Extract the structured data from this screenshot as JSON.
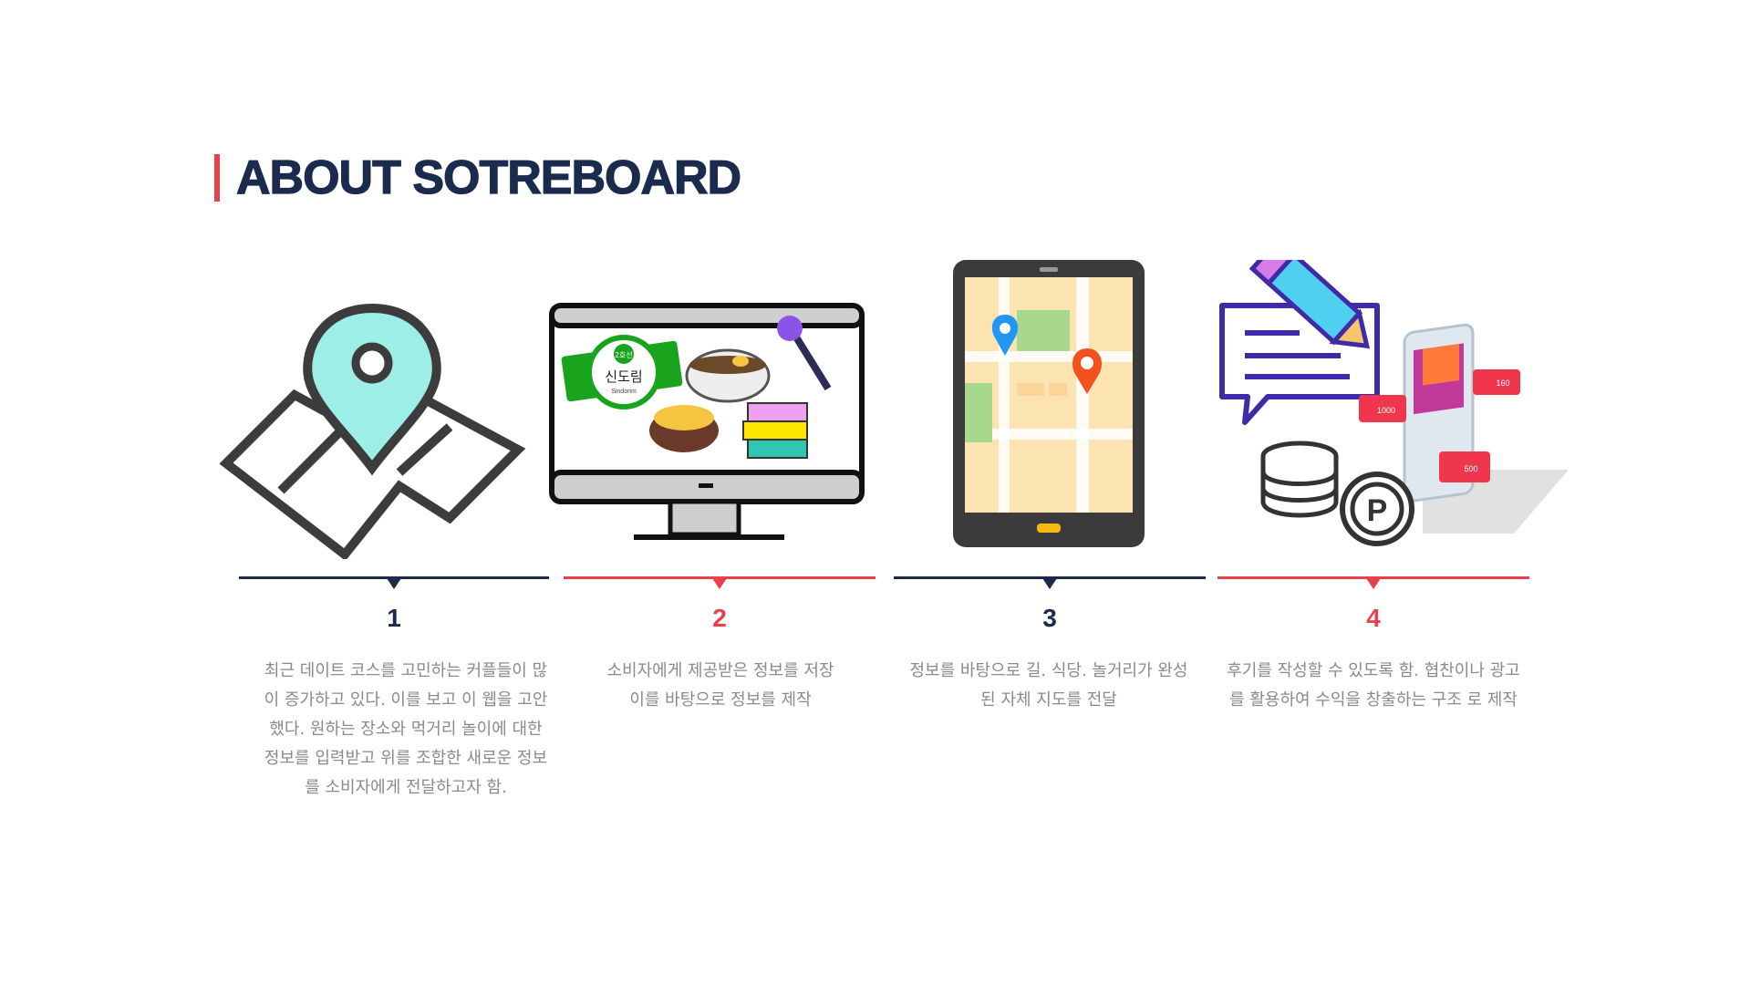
{
  "page": {
    "title": "ABOUT SOTREBOARD"
  },
  "colors": {
    "navy": "#1b2b4e",
    "red": "#e8414b",
    "text_gray": "#8a8a8a"
  },
  "steps": [
    {
      "number": "1",
      "icon": "map-pin-icon",
      "description": "최근 데이트 코스를 고민하는 커플들이 많이 증가하고 있다. 이를 보고 이 웹을 고안했다. 원하는 장소와 먹거리 놀이에 대한 정보를 입력받고 위를 조합한 새로운 정보를 소비자에게 전달하고자 함."
    },
    {
      "number": "2",
      "icon": "monitor-icon",
      "description": "소비자에게 제공받은 정보를 저장 이를 바탕으로 정보를 제작"
    },
    {
      "number": "3",
      "icon": "tablet-map-icon",
      "description": "정보를 바탕으로 길. 식당. 놀거리가 완성된 자체 지도를 전달"
    },
    {
      "number": "4",
      "icon": "review-revenue-icon",
      "description": "후기를 작성할 수 있도록 함. 협찬이나 광고를 활용하여 수익을 창출하는 구조 로 제작"
    }
  ],
  "monitor_screen": {
    "brand_line1": "신도림",
    "brand_line2": "Sindorim",
    "brand_badge": "2호선"
  },
  "social_badges": {
    "likes": "1000",
    "followers": "160",
    "comments": "500"
  },
  "coin_label": "P"
}
